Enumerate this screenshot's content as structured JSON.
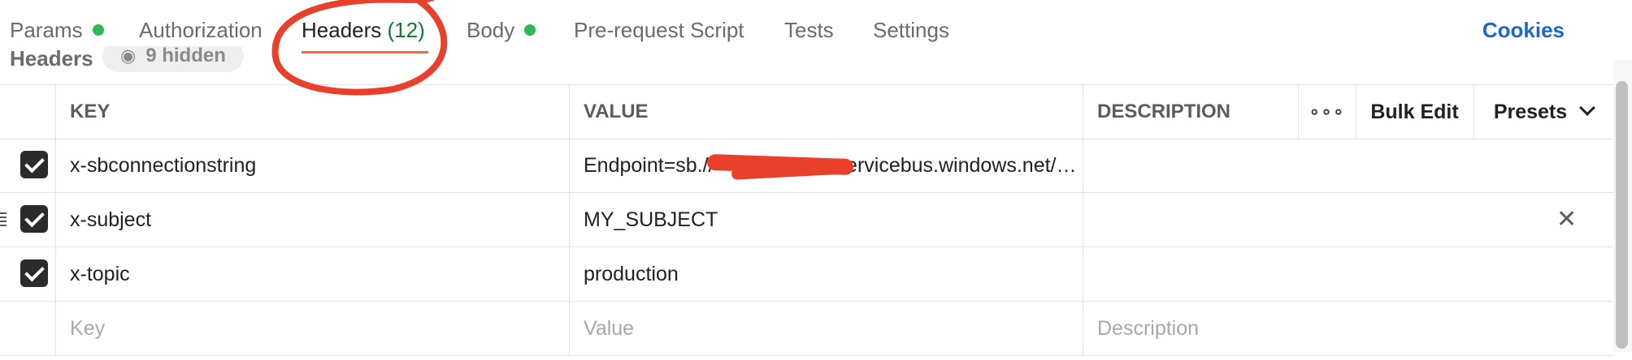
{
  "tabs": [
    {
      "label": "Params",
      "dot": true
    },
    {
      "label": "Authorization"
    },
    {
      "label": "Headers",
      "count": "(12)",
      "active": true
    },
    {
      "label": "Body",
      "dot": true
    },
    {
      "label": "Pre-request Script"
    },
    {
      "label": "Tests"
    },
    {
      "label": "Settings"
    }
  ],
  "cookies_label": "Cookies",
  "section": {
    "title": "Headers",
    "hidden_label": "9 hidden"
  },
  "columns": {
    "key": "KEY",
    "value": "VALUE",
    "description": "DESCRIPTION"
  },
  "toolbar": {
    "more_label": "∘∘∘",
    "bulk_edit": "Bulk Edit",
    "presets": "Presets"
  },
  "rows": [
    {
      "checked": true,
      "key": "x-sbconnectionstring",
      "value_prefix": "Endpoint=sb.//",
      "value_suffix": "servicebus.windows.net/…",
      "description": ""
    },
    {
      "checked": true,
      "key": "x-subject",
      "value": "MY_SUBJECT",
      "description": ""
    },
    {
      "checked": true,
      "key": "x-topic",
      "value": "production",
      "description": ""
    }
  ],
  "new_row": {
    "key_placeholder": "Key",
    "value_placeholder": "Value",
    "description_placeholder": "Description"
  },
  "colors": {
    "accent": "#f26b3a",
    "link": "#1d67c9",
    "status_green": "#2fb956",
    "annotation_red": "#e8402b"
  }
}
